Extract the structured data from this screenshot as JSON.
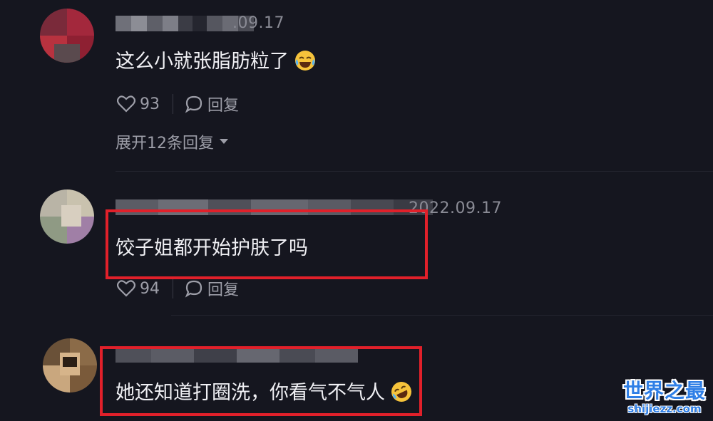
{
  "comments": [
    {
      "date": ".09.17",
      "text": "这么小就张脂肪粒了",
      "emoji": "crying-laughing-emoji",
      "likes": "93",
      "reply_label": "回复",
      "expand_label": "展开12条回复"
    },
    {
      "date": "2022.09.17",
      "text": "饺子姐都开始护肤了吗",
      "likes": "94",
      "reply_label": "回复"
    },
    {
      "text": "她还知道打圈洗，你看气不气人",
      "emoji": "rolling-laughing-emoji"
    }
  ],
  "watermark": {
    "title": "世界之最",
    "url": "shijiezz.com"
  },
  "colors": {
    "background": "#15161f",
    "highlight": "#e1202a",
    "watermark": "#2f7fe6"
  }
}
